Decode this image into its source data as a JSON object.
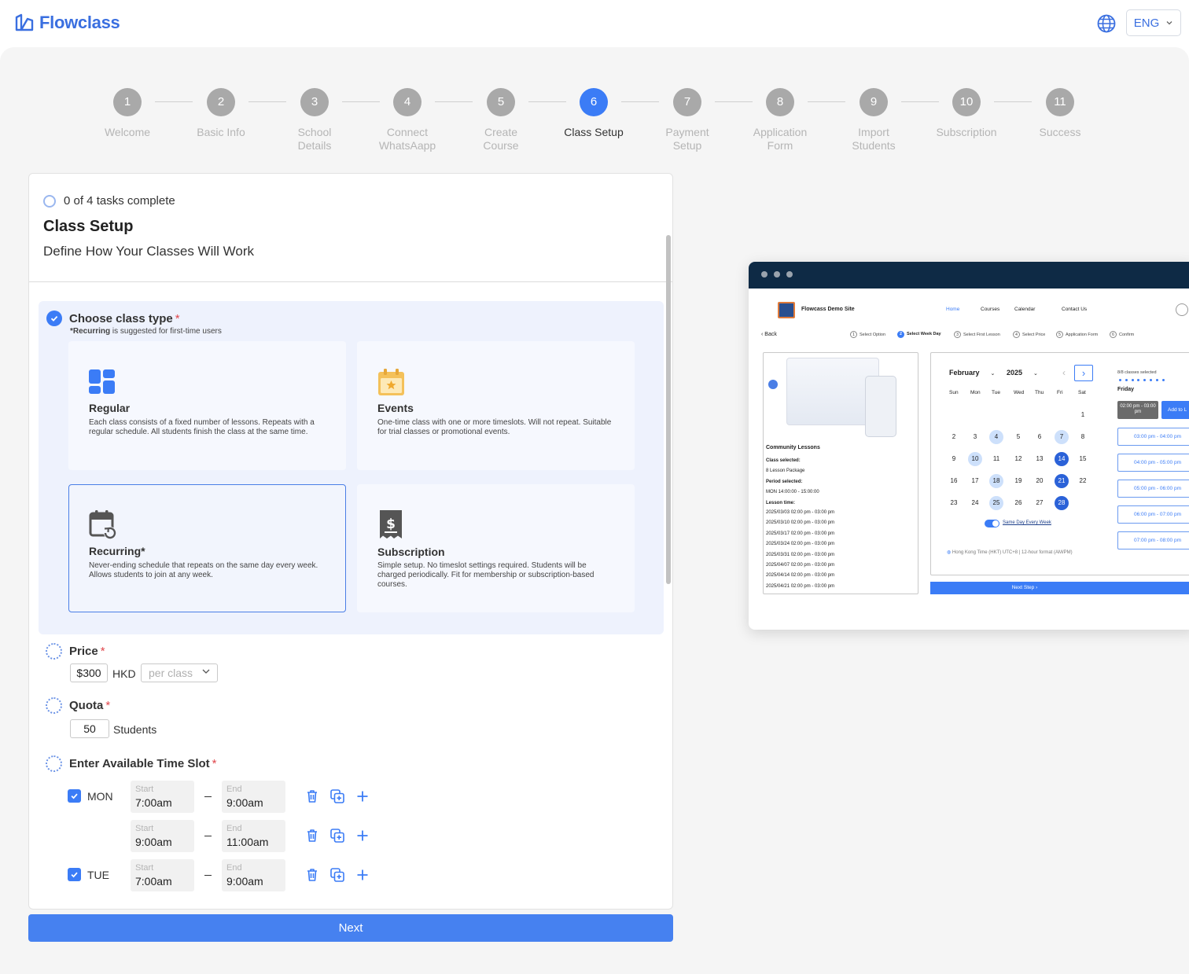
{
  "app": {
    "name": "Flowclass",
    "language": "ENG"
  },
  "stepper": [
    {
      "num": "1",
      "label": "Welcome"
    },
    {
      "num": "2",
      "label": "Basic Info"
    },
    {
      "num": "3",
      "label": "School Details"
    },
    {
      "num": "4",
      "label": "Connect WhatsAapp"
    },
    {
      "num": "5",
      "label": "Create Course"
    },
    {
      "num": "6",
      "label": "Class Setup"
    },
    {
      "num": "7",
      "label": "Payment Setup"
    },
    {
      "num": "8",
      "label": "Application Form"
    },
    {
      "num": "9",
      "label": "Import Students"
    },
    {
      "num": "10",
      "label": "Subscription"
    },
    {
      "num": "11",
      "label": "Success"
    }
  ],
  "active_step": 6,
  "card": {
    "tasks": "0 of 4 tasks complete",
    "title": "Class Setup",
    "subtitle": "Define How Your Classes Will Work"
  },
  "class_type": {
    "title": "Choose class type",
    "required": "*",
    "hint_bold": "*Recurring",
    "hint_rest": " is suggested for first-time users",
    "options": [
      {
        "name": "Regular",
        "desc": "Each class consists of a fixed number of lessons. Repeats with a regular schedule. All students finish the class at the same time."
      },
      {
        "name": "Events",
        "desc": "One-time class with one or more timeslots. Will not repeat. Suitable for trial classes or promotional events."
      },
      {
        "name": "Recurring*",
        "desc": "Never-ending schedule that repeats on the same day every week. Allows students to join at any week."
      },
      {
        "name": "Subscription",
        "desc": "Simple setup. No timeslot settings required. Students will be charged periodically. Fit for membership or subscription-based courses."
      }
    ],
    "selected": "Recurring"
  },
  "price": {
    "title": "Price",
    "value": "$300",
    "currency": "HKD",
    "unit_placeholder": "per class"
  },
  "quota": {
    "title": "Quota",
    "value": "50",
    "unit": "Students"
  },
  "timeslot": {
    "title": "Enter Available Time Slot",
    "start_caption": "Start",
    "end_caption": "End",
    "rows": [
      {
        "day": "MON",
        "start": "7:00am",
        "end": "9:00am"
      },
      {
        "day": "",
        "start": "9:00am",
        "end": "11:00am"
      },
      {
        "day": "TUE",
        "start": "7:00am",
        "end": "9:00am"
      }
    ]
  },
  "next_label": "Next",
  "preview": {
    "site": "Flowcass Demo Site",
    "nav": [
      "Home",
      "Courses",
      "Calendar",
      "Contact Us"
    ],
    "back": "Back",
    "steps": [
      "Select Option",
      "Select Week Day",
      "Select First Lesson",
      "Select Price",
      "Application Form",
      "Confirm"
    ],
    "course_name": "Community Lessons",
    "class_selected_label": "Class selected:",
    "class_selected": "8 Lesson Package",
    "period_label": "Period selected:",
    "period": "MON 14:00:00 - 15:00:00",
    "lesson_time_label": "Lesson time:",
    "lessons": [
      "2025/03/03 02:00 pm - 03:00 pm",
      "2025/03/10 02:00 pm - 03:00 pm",
      "2025/03/17 02:00 pm - 03:00 pm",
      "2025/03/24 02:00 pm - 03:00 pm",
      "2025/03/31 02:00 pm - 03:00 pm",
      "2025/04/07 02:00 pm - 03:00 pm",
      "2025/04/14 02:00 pm - 03:00 pm",
      "2025/04/21 02:00 pm - 03:00 pm"
    ],
    "month": "February",
    "year": "2025",
    "weekdays": [
      "Sun",
      "Mon",
      "Tue",
      "Wed",
      "Thu",
      "Fri",
      "Sat"
    ],
    "weeks": [
      [
        "",
        "",
        "",
        "",
        "",
        "",
        "1"
      ],
      [
        "2",
        "3",
        "4",
        "5",
        "6",
        "7",
        "8"
      ],
      [
        "9",
        "10",
        "11",
        "12",
        "13",
        "14",
        "15"
      ],
      [
        "16",
        "17",
        "18",
        "19",
        "20",
        "21",
        "22"
      ],
      [
        "23",
        "24",
        "25",
        "26",
        "27",
        "28",
        ""
      ]
    ],
    "toggle_label": "Same Day Every Week",
    "timezone": "Hong Kong Time (HKT) UTC+8 | 12-hour format (AM/PM)",
    "classes_selected": "8/8 classes selected",
    "day_label": "Friday",
    "chosen_slot": "02:00 pm - 03:00 pm",
    "add_label": "Add to L",
    "slots": [
      "03:00 pm - 04:00 pm",
      "04:00 pm - 05:00 pm",
      "05:00 pm - 06:00 pm",
      "06:00 pm - 07:00 pm",
      "07:00 pm - 08:00 pm"
    ],
    "next_step": "Next Step"
  },
  "colors": {
    "accent": "#3b7cf6",
    "brand": "#3a6fe0",
    "preview_titlebar": "#0e2a45"
  }
}
